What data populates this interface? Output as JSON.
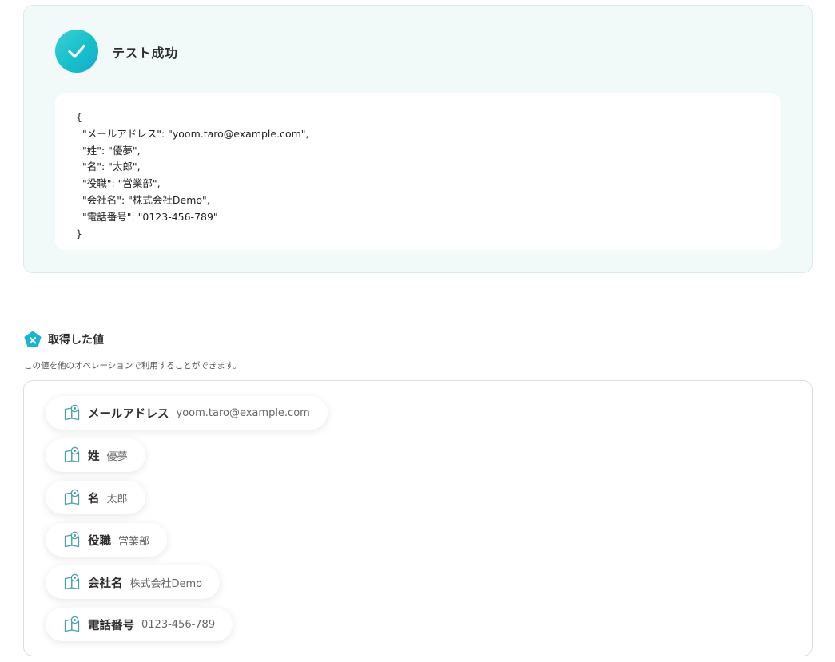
{
  "success": {
    "title": "テスト成功",
    "json_text": "{\n  \"メールアドレス\": \"yoom.taro@example.com\",\n  \"姓\": \"優夢\",\n  \"名\": \"太郎\",\n  \"役職\": \"営業部\",\n  \"会社名\": \"株式会社Demo\",\n  \"電話番号\": \"0123-456-789\"\n}",
    "check_icon": "check-icon",
    "accent_color": "#16c0c9"
  },
  "obtained": {
    "title": "取得した値",
    "description": "この値を他のオペレーションで利用することができます。",
    "heading_icon": "yoom-logo-icon",
    "chip_icon": "data-book-icon",
    "items": [
      {
        "label": "メールアドレス",
        "value": "yoom.taro@example.com"
      },
      {
        "label": "姓",
        "value": "優夢"
      },
      {
        "label": "名",
        "value": "太郎"
      },
      {
        "label": "役職",
        "value": "営業部"
      },
      {
        "label": "会社名",
        "value": "株式会社Demo"
      },
      {
        "label": "電話番号",
        "value": "0123-456-789"
      }
    ]
  }
}
